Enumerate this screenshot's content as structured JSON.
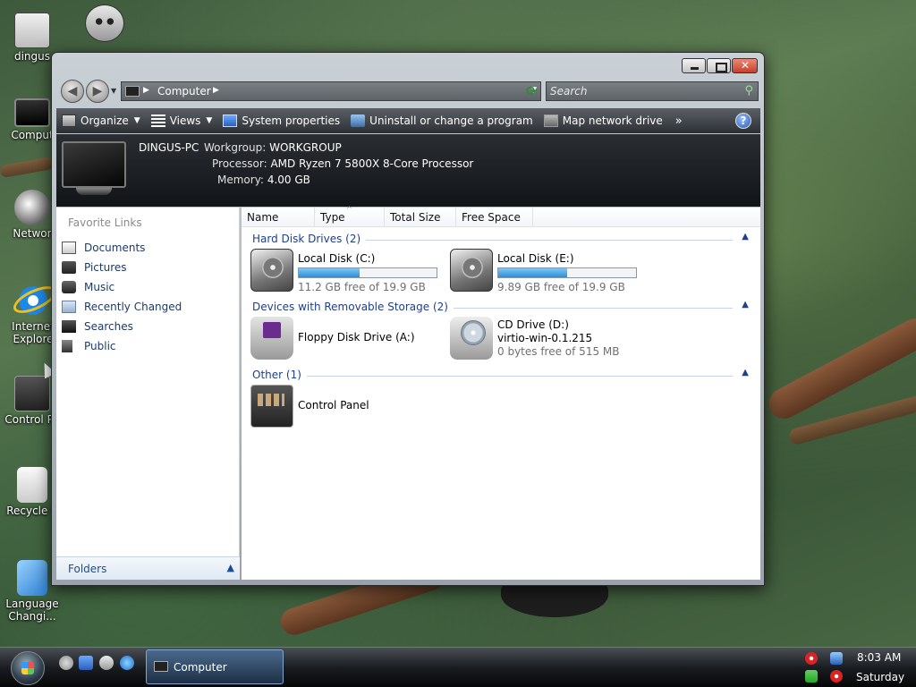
{
  "desktop": {
    "icons": [
      {
        "label": "dingus"
      },
      {
        "label": "Comput"
      },
      {
        "label": "Networ"
      },
      {
        "label": "Internet Explore"
      },
      {
        "label": "Control Pa"
      },
      {
        "label": "Recycle E"
      },
      {
        "label": "Language Changi..."
      }
    ]
  },
  "window": {
    "address": {
      "location": "Computer"
    },
    "search": {
      "placeholder": "Search"
    },
    "toolbar": {
      "organize": "Organize",
      "views": "Views",
      "system_properties": "System properties",
      "uninstall": "Uninstall or change a program",
      "map_drive": "Map network drive",
      "more": "»",
      "help": "?"
    },
    "details": {
      "computer_name": "DINGUS-PC",
      "workgroup_label": "Workgroup:",
      "workgroup": "WORKGROUP",
      "processor_label": "Processor:",
      "processor": "AMD Ryzen 7 5800X 8-Core Processor",
      "memory_label": "Memory:",
      "memory": "4.00 GB"
    },
    "nav": {
      "favorites_title": "Favorite Links",
      "links": [
        "Documents",
        "Pictures",
        "Music",
        "Recently Changed",
        "Searches",
        "Public"
      ],
      "folders": "Folders"
    },
    "columns": {
      "name": "Name",
      "type": "Type",
      "total": "Total Size",
      "free": "Free Space"
    },
    "groups": {
      "hdd": "Hard Disk Drives (2)",
      "removable": "Devices with Removable Storage (2)",
      "other": "Other (1)"
    },
    "drives": {
      "c": {
        "name": "Local Disk (C:)",
        "free": "11.2 GB free of 19.9 GB",
        "used_fraction": 0.44
      },
      "e": {
        "name": "Local Disk (E:)",
        "free": "9.89 GB free of 19.9 GB",
        "used_fraction": 0.5
      },
      "a": {
        "name": "Floppy Disk Drive (A:)"
      },
      "d": {
        "name": "CD Drive (D:)",
        "label": "virtio-win-0.1.215",
        "free": "0 bytes free of 515 MB"
      },
      "cp": {
        "name": "Control Panel"
      }
    }
  },
  "taskbar": {
    "task": "Computer",
    "time": "8:03 AM",
    "day": "Saturday"
  }
}
